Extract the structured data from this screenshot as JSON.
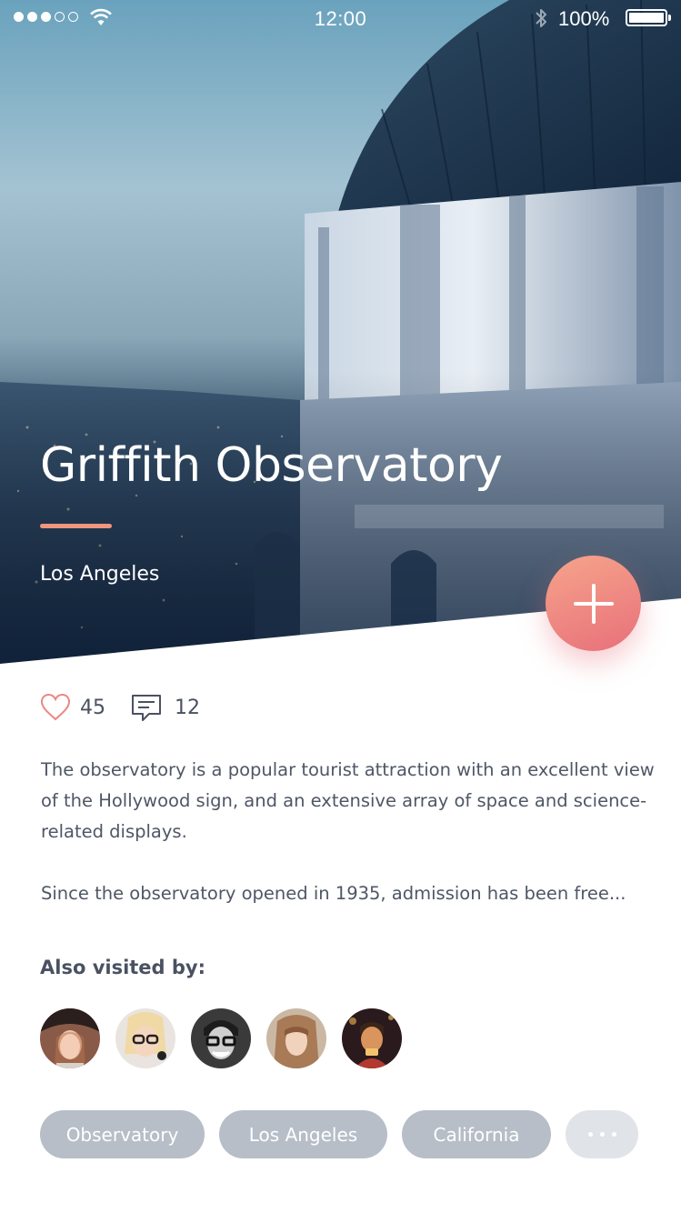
{
  "status_bar": {
    "time": "12:00",
    "battery_percent": "100%",
    "signal_bars_filled": 3,
    "signal_bars_total": 5
  },
  "place": {
    "title": "Griffith Observatory",
    "city": "Los Angeles",
    "accent_color": "#f0957e"
  },
  "actions": {
    "add_icon": "plus-icon"
  },
  "stats": {
    "likes": "45",
    "comments": "12",
    "like_icon": "heart-icon",
    "comment_icon": "comment-icon"
  },
  "description": {
    "paragraph1": "The observatory is a popular tourist attraction with an excellent view of the Hollywood sign, and an extensive array of space and science-related displays.",
    "paragraph2": "Since the observatory opened in 1935, admission has been free..."
  },
  "visitors": {
    "heading": "Also visited by:",
    "count": 5
  },
  "tags": [
    "Observatory",
    "Los Angeles",
    "California"
  ],
  "more_tags_icon": "more-dots-icon"
}
